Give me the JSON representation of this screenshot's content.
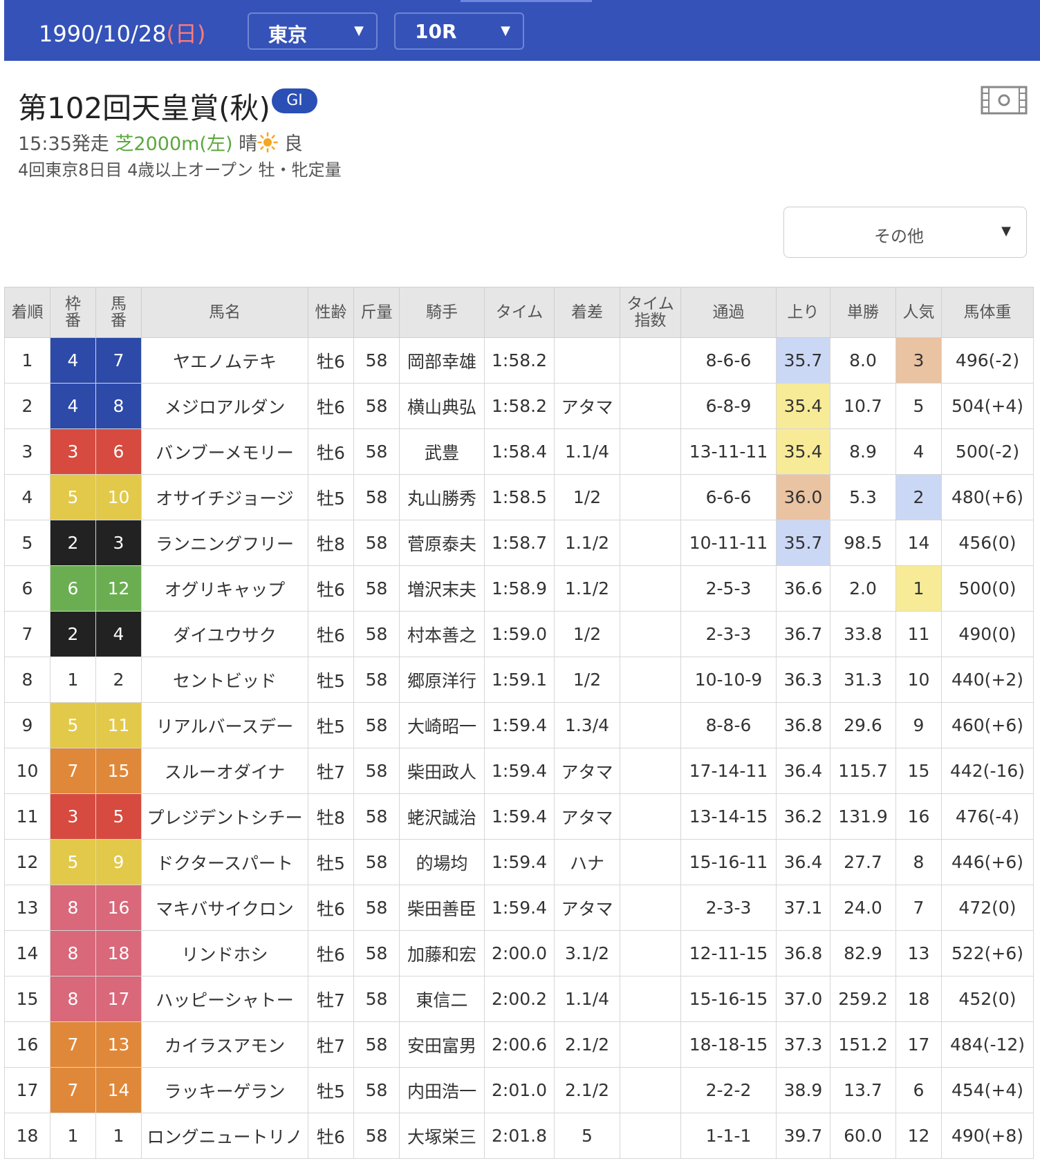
{
  "header": {
    "date": "1990/10/28",
    "day_of_week": "(日)",
    "venue": "東京",
    "race_number": "10R",
    "dropdown_arrow": "▼"
  },
  "race": {
    "title": "第102回天皇賞(秋)",
    "grade": "GI",
    "start_time": "15:35発走",
    "course": "芝2000m(左)",
    "weather": "晴",
    "weather_icon": "sun-icon",
    "track_condition": "良",
    "details": "4回東京8日目 4歳以上オープン 牡・牝定量"
  },
  "other_select": {
    "label": "その他",
    "arrow": "▼"
  },
  "table": {
    "headers": [
      "着順",
      "枠番",
      "馬番",
      "馬名",
      "性齢",
      "斤量",
      "騎手",
      "タイム",
      "着差",
      "タイム指数",
      "通過",
      "上り",
      "単勝",
      "人気",
      "馬体重"
    ],
    "rows": [
      {
        "pos": "1",
        "frame": "4",
        "num": "7",
        "name": "ヤエノムテキ",
        "sexage": "牡6",
        "weight_carried": "58",
        "jockey": "岡部幸雄",
        "time": "1:58.2",
        "margin": "",
        "index": "",
        "passing": "8-6-6",
        "last3f": "35.7",
        "odds": "8.0",
        "pop": "3",
        "body": "496(-2)",
        "last3f_rank": "blue",
        "pop_rank": "orange"
      },
      {
        "pos": "2",
        "frame": "4",
        "num": "8",
        "name": "メジロアルダン",
        "sexage": "牡6",
        "weight_carried": "58",
        "jockey": "横山典弘",
        "time": "1:58.2",
        "margin": "アタマ",
        "index": "",
        "passing": "6-8-9",
        "last3f": "35.4",
        "odds": "10.7",
        "pop": "5",
        "body": "504(+4)",
        "last3f_rank": "yellow",
        "pop_rank": ""
      },
      {
        "pos": "3",
        "frame": "3",
        "num": "6",
        "name": "バンブーメモリー",
        "sexage": "牡6",
        "weight_carried": "58",
        "jockey": "武豊",
        "time": "1:58.4",
        "margin": "1.1/4",
        "index": "",
        "passing": "13-11-11",
        "last3f": "35.4",
        "odds": "8.9",
        "pop": "4",
        "body": "500(-2)",
        "last3f_rank": "yellow",
        "pop_rank": ""
      },
      {
        "pos": "4",
        "frame": "5",
        "num": "10",
        "name": "オサイチジョージ",
        "sexage": "牡5",
        "weight_carried": "58",
        "jockey": "丸山勝秀",
        "time": "1:58.5",
        "margin": "1/2",
        "index": "",
        "passing": "6-6-6",
        "last3f": "36.0",
        "odds": "5.3",
        "pop": "2",
        "body": "480(+6)",
        "last3f_rank": "orange",
        "pop_rank": "blue"
      },
      {
        "pos": "5",
        "frame": "2",
        "num": "3",
        "name": "ランニングフリー",
        "sexage": "牡8",
        "weight_carried": "58",
        "jockey": "菅原泰夫",
        "time": "1:58.7",
        "margin": "1.1/2",
        "index": "",
        "passing": "10-11-11",
        "last3f": "35.7",
        "odds": "98.5",
        "pop": "14",
        "body": "456(0)",
        "last3f_rank": "blue",
        "pop_rank": ""
      },
      {
        "pos": "6",
        "frame": "6",
        "num": "12",
        "name": "オグリキャップ",
        "sexage": "牡6",
        "weight_carried": "58",
        "jockey": "増沢末夫",
        "time": "1:58.9",
        "margin": "1.1/2",
        "index": "",
        "passing": "2-5-3",
        "last3f": "36.6",
        "odds": "2.0",
        "pop": "1",
        "body": "500(0)",
        "last3f_rank": "",
        "pop_rank": "yellow"
      },
      {
        "pos": "7",
        "frame": "2",
        "num": "4",
        "name": "ダイユウサク",
        "sexage": "牡6",
        "weight_carried": "58",
        "jockey": "村本善之",
        "time": "1:59.0",
        "margin": "1/2",
        "index": "",
        "passing": "2-3-3",
        "last3f": "36.7",
        "odds": "33.8",
        "pop": "11",
        "body": "490(0)",
        "last3f_rank": "",
        "pop_rank": ""
      },
      {
        "pos": "8",
        "frame": "1",
        "num": "2",
        "name": "セントビッド",
        "sexage": "牡5",
        "weight_carried": "58",
        "jockey": "郷原洋行",
        "time": "1:59.1",
        "margin": "1/2",
        "index": "",
        "passing": "10-10-9",
        "last3f": "36.3",
        "odds": "31.3",
        "pop": "10",
        "body": "440(+2)",
        "last3f_rank": "",
        "pop_rank": ""
      },
      {
        "pos": "9",
        "frame": "5",
        "num": "11",
        "name": "リアルバースデー",
        "sexage": "牡5",
        "weight_carried": "58",
        "jockey": "大崎昭一",
        "time": "1:59.4",
        "margin": "1.3/4",
        "index": "",
        "passing": "8-8-6",
        "last3f": "36.8",
        "odds": "29.6",
        "pop": "9",
        "body": "460(+6)",
        "last3f_rank": "",
        "pop_rank": ""
      },
      {
        "pos": "10",
        "frame": "7",
        "num": "15",
        "name": "スルーオダイナ",
        "sexage": "牡7",
        "weight_carried": "58",
        "jockey": "柴田政人",
        "time": "1:59.4",
        "margin": "アタマ",
        "index": "",
        "passing": "17-14-11",
        "last3f": "36.4",
        "odds": "115.7",
        "pop": "15",
        "body": "442(-16)",
        "last3f_rank": "",
        "pop_rank": ""
      },
      {
        "pos": "11",
        "frame": "3",
        "num": "5",
        "name": "プレジデントシチー",
        "sexage": "牡8",
        "weight_carried": "58",
        "jockey": "蛯沢誠治",
        "time": "1:59.4",
        "margin": "アタマ",
        "index": "",
        "passing": "13-14-15",
        "last3f": "36.2",
        "odds": "131.9",
        "pop": "16",
        "body": "476(-4)",
        "last3f_rank": "",
        "pop_rank": ""
      },
      {
        "pos": "12",
        "frame": "5",
        "num": "9",
        "name": "ドクタースパート",
        "sexage": "牡5",
        "weight_carried": "58",
        "jockey": "的場均",
        "time": "1:59.4",
        "margin": "ハナ",
        "index": "",
        "passing": "15-16-11",
        "last3f": "36.4",
        "odds": "27.7",
        "pop": "8",
        "body": "446(+6)",
        "last3f_rank": "",
        "pop_rank": ""
      },
      {
        "pos": "13",
        "frame": "8",
        "num": "16",
        "name": "マキバサイクロン",
        "sexage": "牡6",
        "weight_carried": "58",
        "jockey": "柴田善臣",
        "time": "1:59.4",
        "margin": "アタマ",
        "index": "",
        "passing": "2-3-3",
        "last3f": "37.1",
        "odds": "24.0",
        "pop": "7",
        "body": "472(0)",
        "last3f_rank": "",
        "pop_rank": ""
      },
      {
        "pos": "14",
        "frame": "8",
        "num": "18",
        "name": "リンドホシ",
        "sexage": "牡6",
        "weight_carried": "58",
        "jockey": "加藤和宏",
        "time": "2:00.0",
        "margin": "3.1/2",
        "index": "",
        "passing": "12-11-15",
        "last3f": "36.8",
        "odds": "82.9",
        "pop": "13",
        "body": "522(+6)",
        "last3f_rank": "",
        "pop_rank": ""
      },
      {
        "pos": "15",
        "frame": "8",
        "num": "17",
        "name": "ハッピーシャトー",
        "sexage": "牡7",
        "weight_carried": "58",
        "jockey": "東信二",
        "time": "2:00.2",
        "margin": "1.1/4",
        "index": "",
        "passing": "15-16-15",
        "last3f": "37.0",
        "odds": "259.2",
        "pop": "18",
        "body": "452(0)",
        "last3f_rank": "",
        "pop_rank": ""
      },
      {
        "pos": "16",
        "frame": "7",
        "num": "13",
        "name": "カイラスアモン",
        "sexage": "牡7",
        "weight_carried": "58",
        "jockey": "安田富男",
        "time": "2:00.6",
        "margin": "2.1/2",
        "index": "",
        "passing": "18-18-15",
        "last3f": "37.3",
        "odds": "151.2",
        "pop": "17",
        "body": "484(-12)",
        "last3f_rank": "",
        "pop_rank": ""
      },
      {
        "pos": "17",
        "frame": "7",
        "num": "14",
        "name": "ラッキーゲラン",
        "sexage": "牡5",
        "weight_carried": "58",
        "jockey": "内田浩一",
        "time": "2:01.0",
        "margin": "2.1/2",
        "index": "",
        "passing": "2-2-2",
        "last3f": "38.9",
        "odds": "13.7",
        "pop": "6",
        "body": "454(+4)",
        "last3f_rank": "",
        "pop_rank": ""
      },
      {
        "pos": "18",
        "frame": "1",
        "num": "1",
        "name": "ロングニュートリノ",
        "sexage": "牡6",
        "weight_carried": "58",
        "jockey": "大塚栄三",
        "time": "2:01.8",
        "margin": "5",
        "index": "",
        "passing": "1-1-1",
        "last3f": "39.7",
        "odds": "60.0",
        "pop": "12",
        "body": "490(+8)",
        "last3f_rank": "",
        "pop_rank": ""
      }
    ]
  }
}
